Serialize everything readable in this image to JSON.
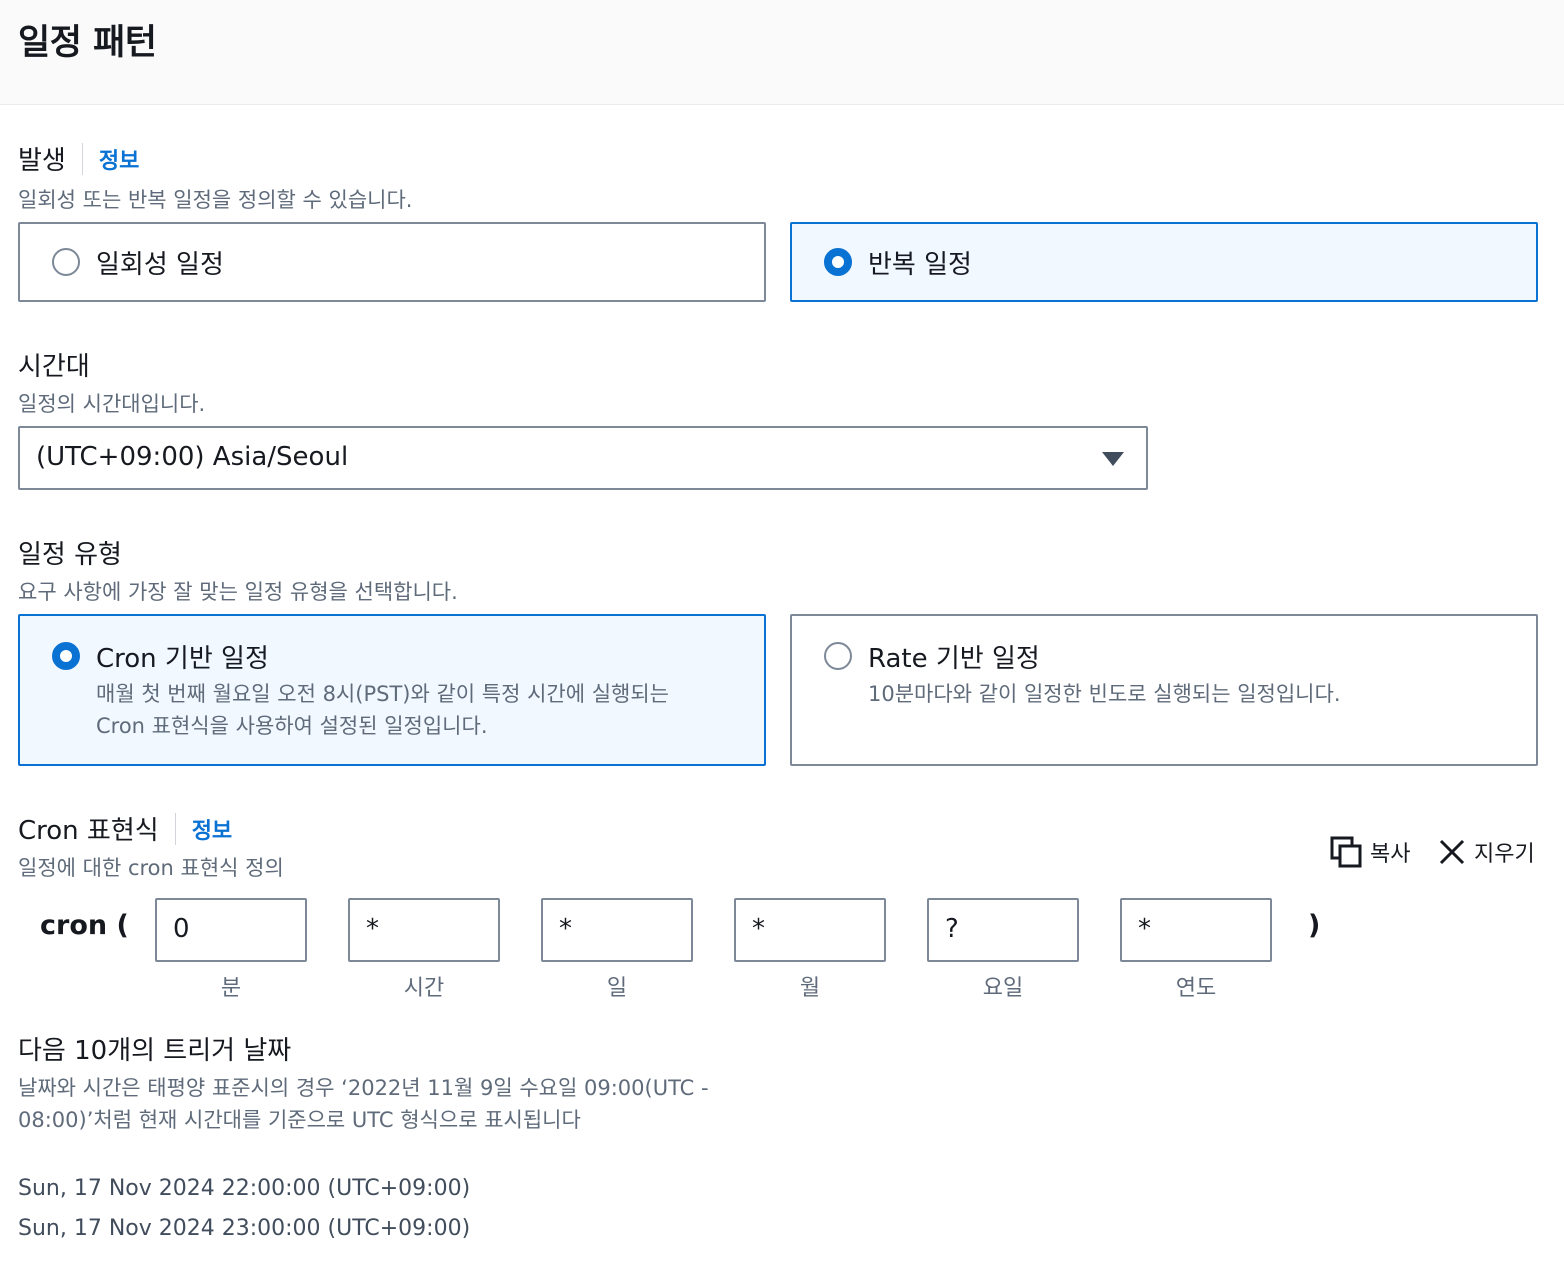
{
  "header": {
    "title": "일정 패턴"
  },
  "occurrence": {
    "label": "발생",
    "info": "정보",
    "description": "일회성 또는 반복 일정을 정의할 수 있습니다.",
    "options": [
      {
        "label": "일회성 일정",
        "selected": false
      },
      {
        "label": "반복 일정",
        "selected": true
      }
    ]
  },
  "timezone": {
    "label": "시간대",
    "description": "일정의 시간대입니다.",
    "value": "(UTC+09:00) Asia/Seoul"
  },
  "schedule_type": {
    "label": "일정 유형",
    "description": "요구 사항에 가장 잘 맞는 일정 유형을 선택합니다.",
    "options": [
      {
        "label": "Cron 기반 일정",
        "description_line1": "매월 첫 번째 월요일 오전 8시(PST)와 같이 특정 시간에 실행되는",
        "description_line2": "Cron 표현식을 사용하여 설정된 일정입니다.",
        "selected": true
      },
      {
        "label": "Rate 기반 일정",
        "description_line1": "10분마다와 같이 일정한 빈도로 실행되는 일정입니다.",
        "selected": false
      }
    ]
  },
  "cron": {
    "label": "Cron 표현식",
    "info": "정보",
    "description": "일정에 대한 cron 표현식 정의",
    "copy_label": "복사",
    "clear_label": "지우기",
    "prefix": "cron (",
    "suffix": ")",
    "fields": [
      {
        "value": "0",
        "label": "분"
      },
      {
        "value": "*",
        "label": "시간"
      },
      {
        "value": "*",
        "label": "일"
      },
      {
        "value": "*",
        "label": "월"
      },
      {
        "value": "?",
        "label": "요일"
      },
      {
        "value": "*",
        "label": "연도"
      }
    ]
  },
  "triggers": {
    "label": "다음 10개의 트리거 날짜",
    "description_line1": "날짜와 시간은 태평양 표준시의 경우 ‘2022년 11월 9일 수요일 09:00(UTC -",
    "description_line2": "08:00)’처럼 현재 시간대를 기준으로 UTC 형식으로 표시됩니다",
    "dates": [
      "Sun, 17 Nov 2024 22:00:00 (UTC+09:00)",
      "Sun, 17 Nov 2024 23:00:00 (UTC+09:00)"
    ]
  },
  "colors": {
    "accent": "#0972d3",
    "selected_bg": "#f1f8ff",
    "border": "#7d8998",
    "muted_text": "#5f6b7a"
  }
}
